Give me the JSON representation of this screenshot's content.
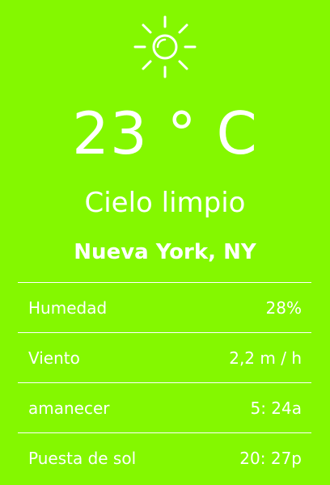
{
  "weather": {
    "icon": "sun-icon",
    "temperature": "23 ° C",
    "condition": "Cielo limpio",
    "city": "Nueva York, NY"
  },
  "details": [
    {
      "label": "Humedad",
      "value": "28%"
    },
    {
      "label": "Viento",
      "value": "2,2 m / h"
    },
    {
      "label": "amanecer",
      "value": "5: 24a"
    },
    {
      "label": "Puesta de sol",
      "value": "20: 27p"
    }
  ],
  "colors": {
    "background": "#84f800",
    "foreground": "#ffffff"
  }
}
